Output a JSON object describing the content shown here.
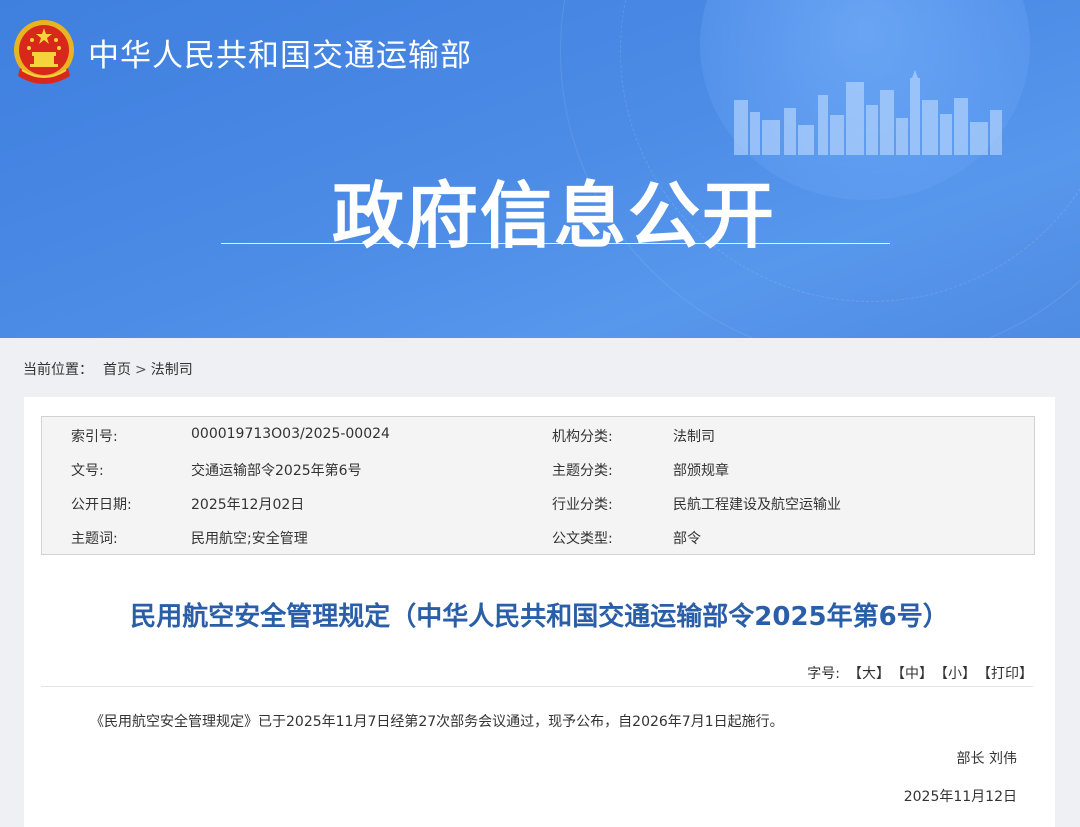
{
  "header": {
    "ministry_name": "中华人民共和国交通运输部",
    "banner_title": "政府信息公开",
    "emblem_icon": "national-emblem-icon"
  },
  "breadcrumb": {
    "label": "当前位置：",
    "home": "首页",
    "separator": ">",
    "current": "法制司"
  },
  "metadata": {
    "rows": [
      {
        "k1": "索引号:",
        "v1": "000019713O03/2025-00024",
        "k2": "机构分类:",
        "v2": "法制司"
      },
      {
        "k1": "文号:",
        "v1": "交通运输部令2025年第6号",
        "k2": "主题分类:",
        "v2": "部颁规章"
      },
      {
        "k1": "公开日期:",
        "v1": "2025年12月02日",
        "k2": "行业分类:",
        "v2": "民航工程建设及航空运输业"
      },
      {
        "k1": "主题词:",
        "v1": "民用航空;安全管理",
        "k2": "公文类型:",
        "v2": "部令"
      }
    ]
  },
  "document": {
    "title": "民用航空安全管理规定（中华人民共和国交通运输部令2025年第6号）",
    "font_label": "字号:",
    "font_large": "【大】",
    "font_medium": "【中】",
    "font_small": "【小】",
    "print": "【打印】",
    "body": "《民用航空安全管理规定》已于2025年11月7日经第27次部务会议通过，现予公布，自2026年7月1日起施行。",
    "signature": "部长 刘伟",
    "date": "2025年11月12日"
  },
  "colors": {
    "banner": "#4b8ae5",
    "title": "#2a5ea8",
    "page_bg": "#eef0f3"
  }
}
